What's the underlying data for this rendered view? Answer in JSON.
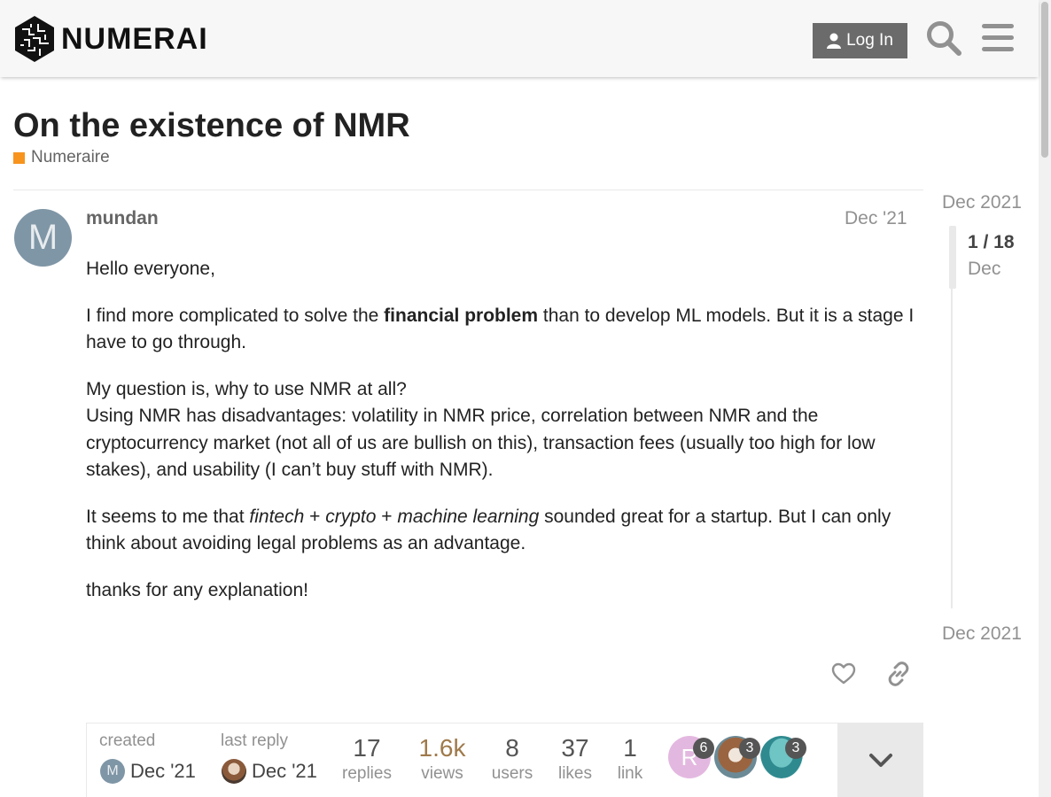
{
  "header": {
    "brand": "NUMERAI",
    "login_label": "Log In"
  },
  "topic": {
    "title": "On the existence of NMR",
    "category": "Numeraire",
    "category_color": "#f7941d"
  },
  "post": {
    "avatar_letter": "M",
    "username": "mundan",
    "date": "Dec '21",
    "p1": "Hello everyone,",
    "p2_a": "I find more complicated to solve the ",
    "p2_b": "financial problem",
    "p2_c": " than to develop ML models. But it is a stage I have to go through.",
    "p3_a": "My question is, why to use NMR at all?",
    "p3_b": "Using NMR has disadvantages: volatility in NMR price, correlation between NMR and the cryptocurrency market (not all of us are bullish on this), transaction fees (usually too high for low stakes), and usability (I can’t buy stuff with NMR).",
    "p4_a": "It seems to me that ",
    "p4_b": "fintech",
    "p4_c": " + ",
    "p4_d": "crypto",
    "p4_e": " + ",
    "p4_f": "machine learning",
    "p4_g": " sounded great for a startup. But I can only think about avoiding legal problems as an advantage.",
    "p5": "thanks for any explanation!"
  },
  "topic_map": {
    "created_label": "created",
    "created_date": "Dec '21",
    "created_avatar_letter": "M",
    "last_reply_label": "last reply",
    "last_reply_date": "Dec '21",
    "stats": [
      {
        "num": "17",
        "label": "replies"
      },
      {
        "num": "1.6k",
        "label": "views"
      },
      {
        "num": "8",
        "label": "users"
      },
      {
        "num": "37",
        "label": "likes"
      },
      {
        "num": "1",
        "label": "link"
      }
    ],
    "participants": [
      {
        "letter": "R",
        "count": "6"
      },
      {
        "letter": "",
        "count": "3"
      },
      {
        "letter": "",
        "count": "3"
      }
    ]
  },
  "timeline": {
    "top_date": "Dec 2021",
    "position": "1 / 18",
    "sub": "Dec",
    "bottom_date": "Dec 2021"
  }
}
